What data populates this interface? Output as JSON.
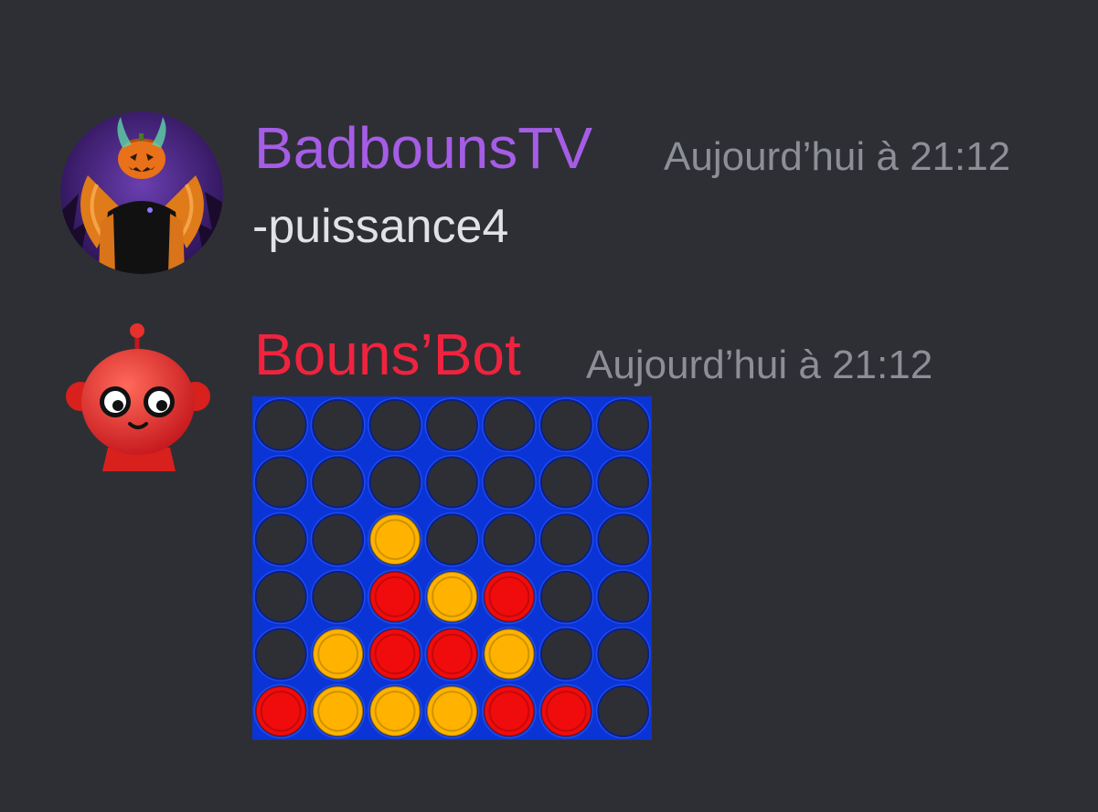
{
  "messages": [
    {
      "author": "BadbounsTV",
      "author_color": "#a55de6",
      "timestamp": "Aujourd’hui à  21:12",
      "content": "-puissance4",
      "avatar_icon": "pumpkin-head-avatar"
    },
    {
      "author": "Bouns’Bot",
      "author_color": "#f0233f",
      "timestamp": "Aujourd’hui à 21:12",
      "avatar_icon": "red-robot-avatar",
      "attachment": {
        "type": "connect-four-board",
        "rows": 6,
        "cols": 7,
        "colors": {
          "board": "#0a34d6",
          "hole": "#2e2f34",
          "red": "#f00c0c",
          "yellow": "#ffb300"
        },
        "grid": [
          [
            "",
            "",
            "",
            "",
            "",
            "",
            ""
          ],
          [
            "",
            "",
            "",
            "",
            "",
            "",
            ""
          ],
          [
            "",
            "",
            "Y",
            "",
            "",
            "",
            ""
          ],
          [
            "",
            "",
            "R",
            "Y",
            "R",
            "",
            ""
          ],
          [
            "",
            "Y",
            "R",
            "R",
            "Y",
            "",
            ""
          ],
          [
            "R",
            "Y",
            "Y",
            "Y",
            "R",
            "R",
            ""
          ]
        ]
      }
    }
  ]
}
